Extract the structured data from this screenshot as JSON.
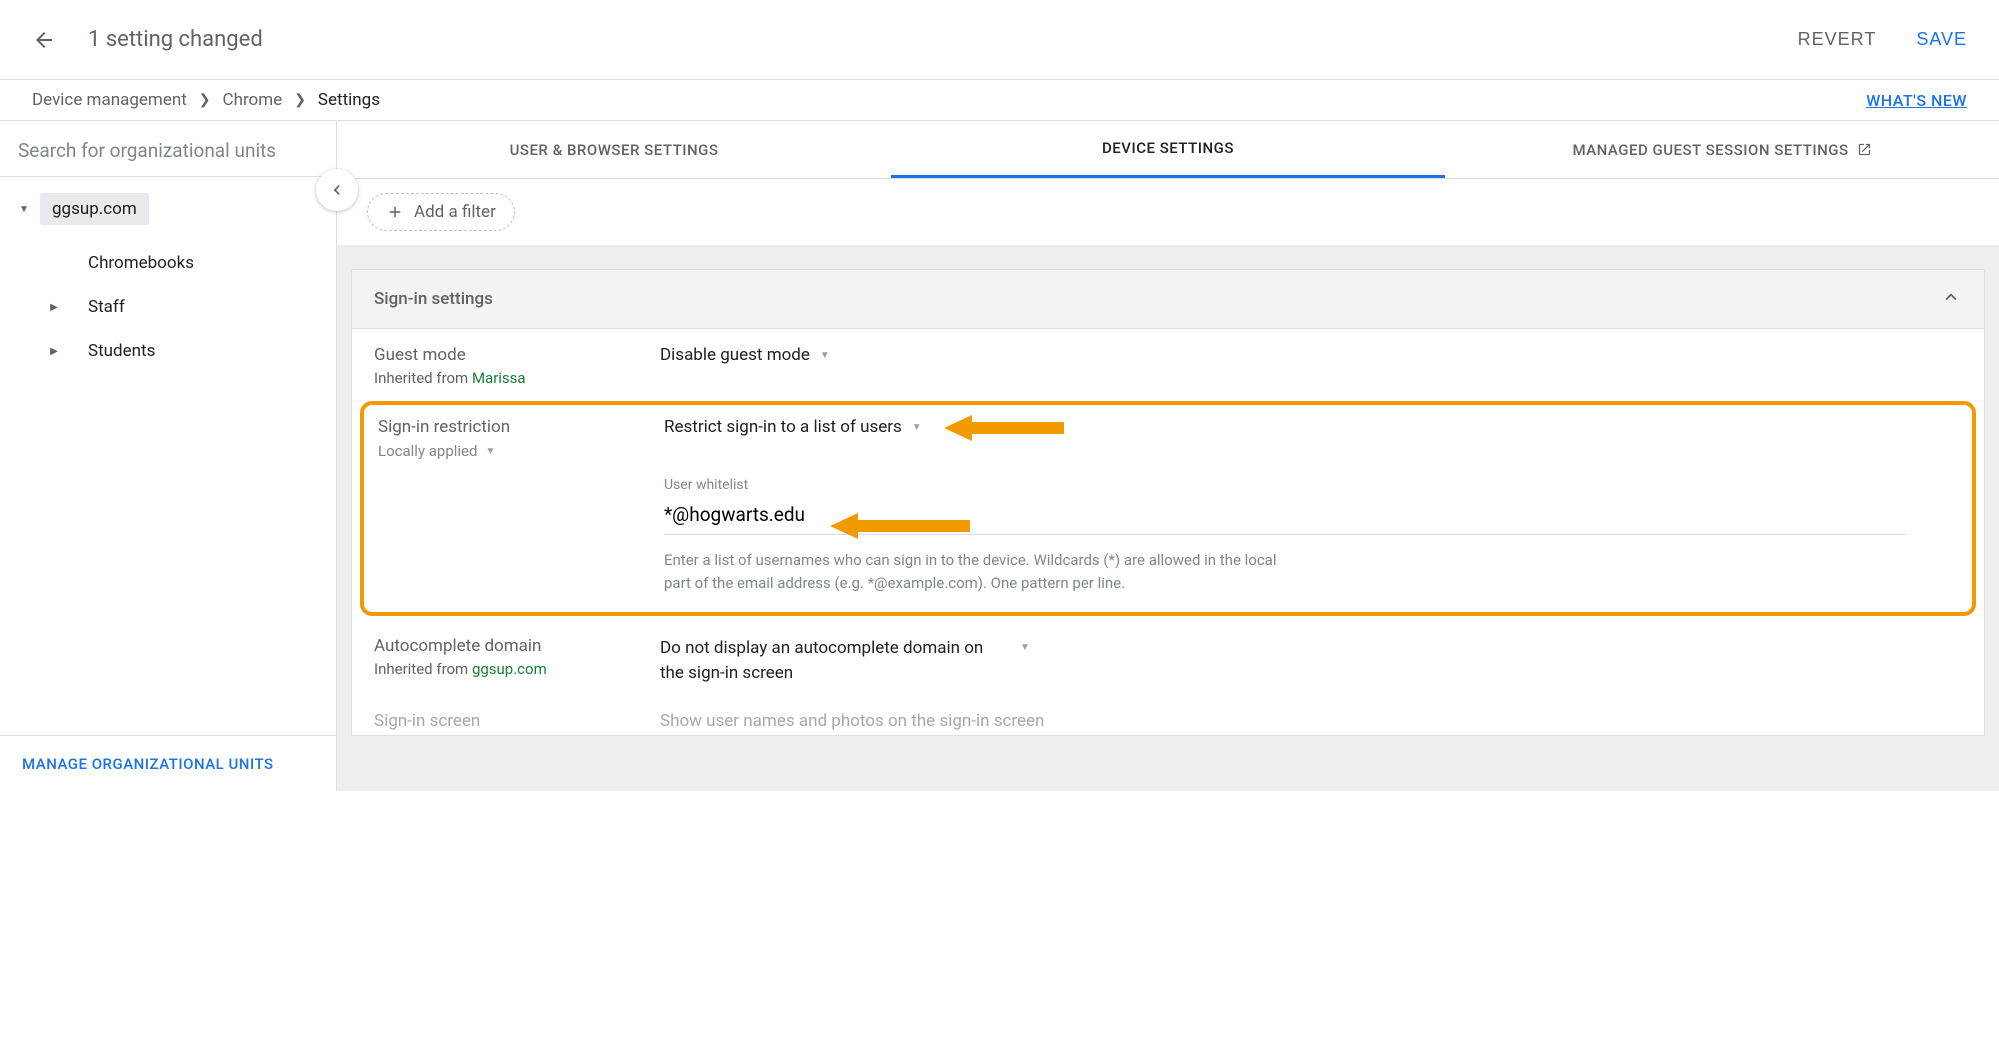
{
  "topbar": {
    "title": "1 setting changed",
    "revert": "REVERT",
    "save": "SAVE"
  },
  "breadcrumb": {
    "items": [
      "Device management",
      "Chrome",
      "Settings"
    ],
    "whats_new": "WHAT'S NEW"
  },
  "sidebar": {
    "search_placeholder": "Search for organizational units",
    "root": "ggsup.com",
    "children": [
      "Chromebooks",
      "Staff",
      "Students"
    ],
    "manage": "MANAGE ORGANIZATIONAL UNITS"
  },
  "tabs": {
    "user_browser": "USER & BROWSER SETTINGS",
    "device": "DEVICE SETTINGS",
    "guest": "MANAGED GUEST SESSION SETTINGS"
  },
  "filter": {
    "add": "Add a filter"
  },
  "section": {
    "title": "Sign-in settings",
    "guest_mode": {
      "name": "Guest mode",
      "inherit_prefix": "Inherited from ",
      "inherit_link": "Marissa",
      "value": "Disable guest mode"
    },
    "signin_restriction": {
      "name": "Sign-in restriction",
      "applied": "Locally applied",
      "value": "Restrict sign-in to a list of users",
      "whitelist_label": "User whitelist",
      "whitelist_value": "*@hogwarts.edu",
      "help": "Enter a list of usernames who can sign in to the device. Wildcards (*) are allowed in the local part of the email address (e.g. *@example.com). One pattern per line."
    },
    "autocomplete": {
      "name": "Autocomplete domain",
      "inherit_prefix": "Inherited from ",
      "inherit_link": "ggsup.com",
      "value": "Do not display an autocomplete domain on the sign-in screen"
    },
    "signin_screen": {
      "name": "Sign-in screen",
      "value": "Show user names and photos on the sign-in screen"
    }
  }
}
